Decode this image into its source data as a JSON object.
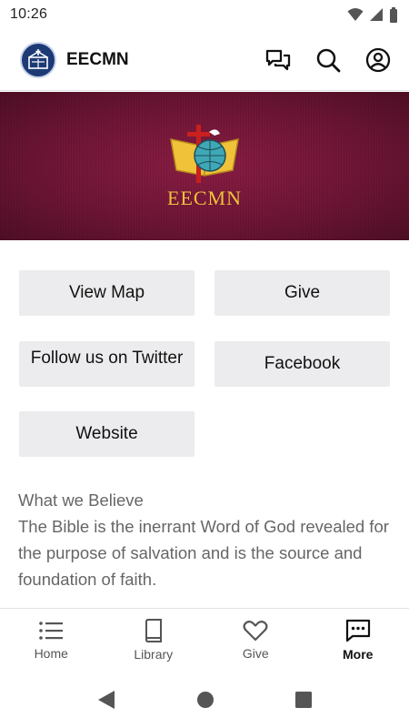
{
  "status_bar": {
    "time": "10:26"
  },
  "header": {
    "title": "EECMN"
  },
  "banner": {
    "logo_text": "EECMN"
  },
  "buttons": {
    "view_map": "View Map",
    "give": "Give",
    "follow_twitter": "Follow us on Twitter",
    "facebook": "Facebook",
    "website": "Website"
  },
  "believe": {
    "heading": "What we Believe",
    "body": "The Bible is the inerrant Word of God revealed for the purpose of salvation and is the source and foundation of faith."
  },
  "bottom_nav": {
    "items": [
      {
        "label": "Home",
        "icon": "list-icon"
      },
      {
        "label": "Library",
        "icon": "book-icon"
      },
      {
        "label": "Give",
        "icon": "heart-icon"
      },
      {
        "label": "More",
        "icon": "chat-dots-icon",
        "active": true
      }
    ]
  },
  "colors": {
    "banner": "#6e1535",
    "accent_gold": "#f0c23a",
    "logo_blue": "#1d3a75",
    "tile_bg": "#ececee"
  }
}
